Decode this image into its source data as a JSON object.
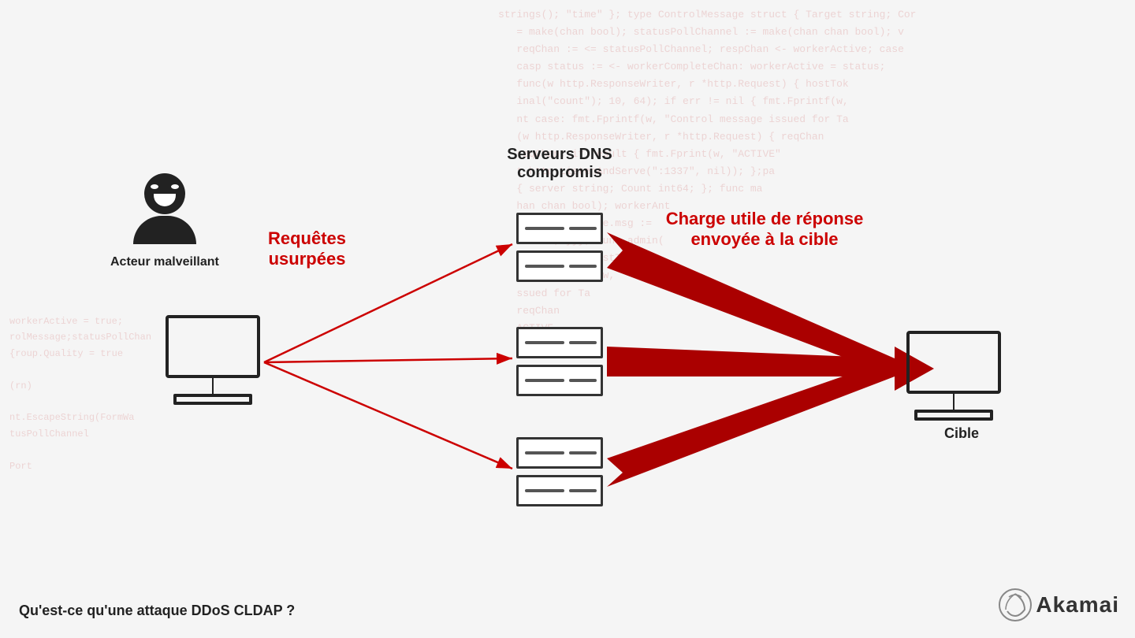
{
  "background": {
    "code_text": "strings(); \"time\" }; type ControlMessage struct { Target string; Cor\n   = make(chan bool); statusPollChannel := make(chan chan bool); v\n   reqChan := <= statusPollChannel; respChan <- workerActive; case\n   casp status := <- workerCompleteChan: workerActive = status;\n   func(w http.ResponseWriter, r *http.Request) { hostTok\n   inal(\"count\"); 10, 64); if err != nil { fmt.Fprintf(w,\n   nt case: fmt.Fprintf(w, \"Control message issued for Ta\n   (w http.ResponseWriter, r *http.Request) { reqChan\n   reqChan; if result { fmt.Fprint(w, \"ACTIVE\"\n   t http.ListenAndServe(\":1337\", nil)); };pa\n   { server string; Count int64; }; func ma\n   han chan bool); workerAnt\n   rkerActive;case.msg :=\n   status; }}}; func admin(\n   Request;} { hostTokens\n   } fmt.Fprintf(w,\n   ssued for Ta\n   reqChan\n   ACTIVE"
  },
  "code_left": "workerActive = true;\nrolMessage;statusPollChan\n{roup.Quality = true\n\n(rn)\n\nnt.EscapeString(FormWa\ntusPollChannel\n\nPort",
  "diagram": {
    "actor_label": "Acteur malveillant",
    "dns_label_line1": "Serveurs DNS",
    "dns_label_line2": "compromis",
    "requetes_label_line1": "Requêtes",
    "requetes_label_line2": "usurpées",
    "charge_label_line1": "Charge utile de réponse",
    "charge_label_line2": "envoyée à la cible",
    "cible_label": "Cible"
  },
  "bottom_label": "Qu'est-ce qu'une attaque DDoS CLDAP ?",
  "akamai": {
    "text": "Akamai"
  }
}
